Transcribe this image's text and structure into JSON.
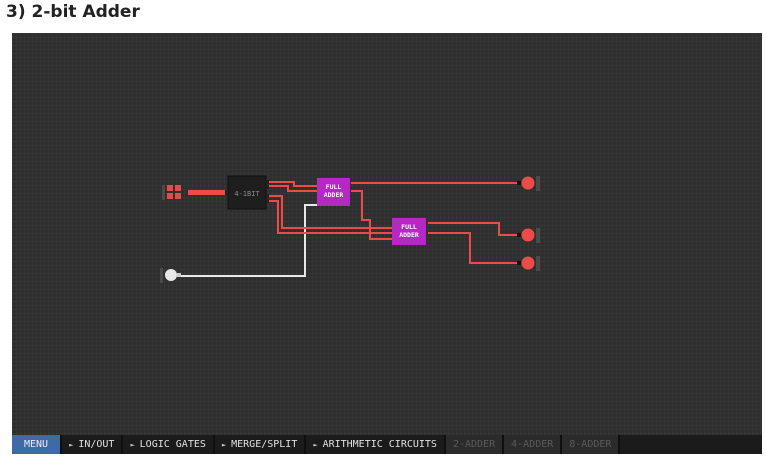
{
  "page": {
    "title": "3) 2-bit Adder"
  },
  "circuit": {
    "split_label": "4-1BIT",
    "full_adder_1": {
      "line1": "FULL",
      "line2": "ADDER"
    },
    "full_adder_2": {
      "line1": "FULL",
      "line2": "ADDER"
    }
  },
  "toolbar": {
    "menu": "MENU",
    "items": [
      {
        "label": "IN/OUT",
        "arrow": "►"
      },
      {
        "label": "LOGIC GATES",
        "arrow": "►"
      },
      {
        "label": "MERGE/SPLIT",
        "arrow": "►"
      },
      {
        "label": "ARITHMETIC CIRCUITS",
        "arrow": "►"
      }
    ],
    "disabled": [
      "2-ADDER",
      "4-ADDER",
      "8-ADDER"
    ]
  },
  "colors": {
    "wire_on": "#ee4a4a",
    "wire_off": "#e8e8e8",
    "chip_purple": "#b528c4",
    "menu_blue": "#3e6aa6",
    "canvas": "#2e2e2e"
  }
}
